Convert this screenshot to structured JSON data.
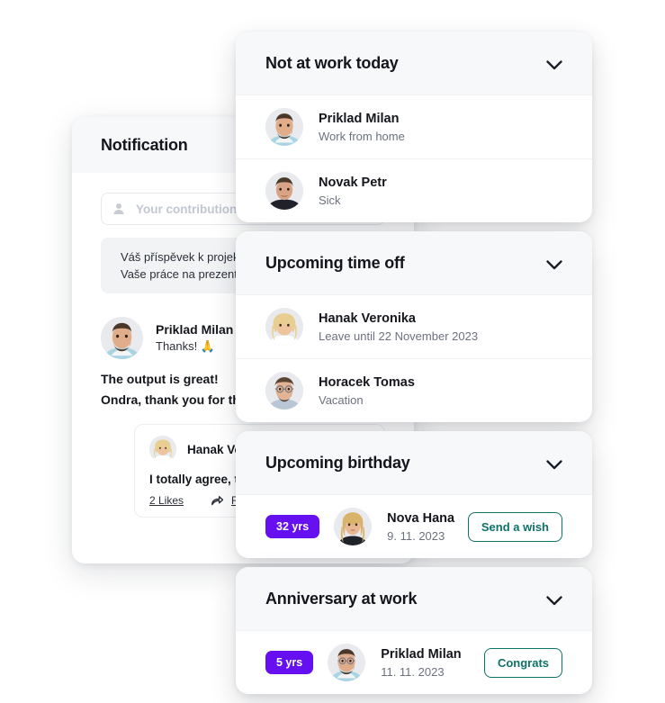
{
  "notification_panel": {
    "title": "Notification",
    "compose": {
      "icon": "person-icon",
      "placeholder": "Your contribution to the project was amazing!"
    },
    "suggestions": [
      "Váš příspěvek k projekt",
      "Vaše práce na prezenta"
    ],
    "comment": {
      "author": "Priklad Milan",
      "subtext": "Thanks! 🙏",
      "body": "The output is great!\nOndra, thank you for th",
      "body_line_1": "The output is great!",
      "body_line_2": "Ondra, thank you for th"
    },
    "reply": {
      "author": "Hanak Veronika",
      "text": "I totally agree, thank y",
      "likes_label": "2 Likes",
      "reply_label": "Reply",
      "reply_icon": "reply-arrow-icon"
    }
  },
  "cards": [
    {
      "title": "Not at work today",
      "chevron_icon": "chevron-down-icon",
      "rows": [
        {
          "name": "Priklad Milan",
          "sub": "Work from home"
        },
        {
          "name": "Novak Petr",
          "sub": "Sick"
        }
      ]
    },
    {
      "title": "Upcoming time off",
      "chevron_icon": "chevron-down-icon",
      "rows": [
        {
          "name": "Hanak Veronika",
          "sub": "Leave until 22 November 2023"
        },
        {
          "name": "Horacek Tomas",
          "sub": "Vacation"
        }
      ]
    },
    {
      "title": "Upcoming birthday",
      "chevron_icon": "chevron-down-icon",
      "rows": [
        {
          "badge": "32 yrs",
          "name": "Nova Hana",
          "sub": "9. 11. 2023",
          "button": "Send a wish"
        }
      ]
    },
    {
      "title": "Anniversary at work",
      "chevron_icon": "chevron-down-icon",
      "rows": [
        {
          "badge": "5 yrs",
          "name": "Priklad Milan",
          "sub": "11. 11. 2023",
          "button": "Congrats"
        }
      ]
    }
  ],
  "colors": {
    "badge_purple": "#6610f2",
    "button_teal": "#0d7268",
    "header_gray": "#f7f8fa",
    "text_dark": "#14161c",
    "text_muted": "#6c717f"
  }
}
